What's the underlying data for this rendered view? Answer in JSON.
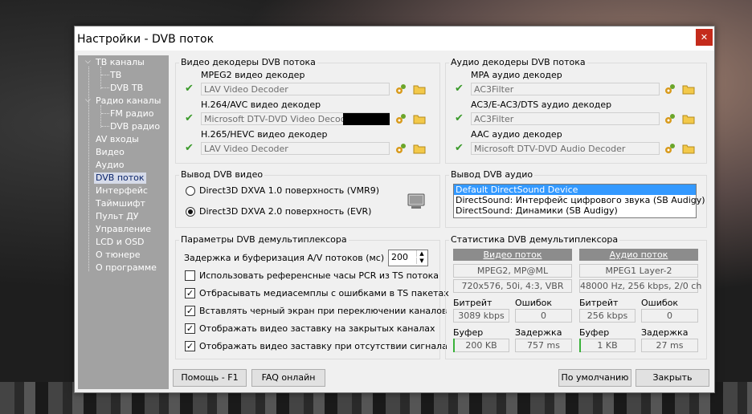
{
  "window": {
    "title": "Настройки - DVB поток",
    "close": "✕"
  },
  "sidebar": {
    "items": [
      {
        "label": "ТВ каналы",
        "toggle": "⌵"
      },
      {
        "label": "ТВ"
      },
      {
        "label": "DVB ТВ"
      },
      {
        "label": "Радио каналы",
        "toggle": "⌵"
      },
      {
        "label": "FM радио"
      },
      {
        "label": "DVB радио"
      },
      {
        "label": "AV входы"
      },
      {
        "label": "Видео"
      },
      {
        "label": "Аудио"
      },
      {
        "label": "DVB поток",
        "selected": true
      },
      {
        "label": "Интерфейс"
      },
      {
        "label": "Таймшифт"
      },
      {
        "label": "Пульт ДУ"
      },
      {
        "label": "Управление"
      },
      {
        "label": "LCD и OSD"
      },
      {
        "label": "О тюнере"
      },
      {
        "label": "О программе"
      }
    ]
  },
  "video_decoders": {
    "title": "Видео декодеры DVB потока",
    "rows": [
      {
        "label": "MPEG2 видео декодер",
        "value": "LAV Video Decoder"
      },
      {
        "label": "H.264/AVC видео декодер",
        "value": "Microsoft DTV-DVD Video Decoder"
      },
      {
        "label": "H.265/HEVC видео декодер",
        "value": "LAV Video Decoder"
      }
    ]
  },
  "audio_decoders": {
    "title": "Аудио декодеры DVB потока",
    "rows": [
      {
        "label": "MPA аудио декодер",
        "value": "AC3Filter"
      },
      {
        "label": "AC3/E-AC3/DTS аудио декодер",
        "value": "AC3Filter"
      },
      {
        "label": "AAC аудио декодер",
        "value": "Microsoft DTV-DVD Audio Decoder"
      }
    ]
  },
  "video_output": {
    "title": "Вывод DVB видео",
    "options": [
      {
        "label": "Direct3D DXVA 1.0 поверхность (VMR9)",
        "checked": false
      },
      {
        "label": "Direct3D DXVA 2.0 поверхность (EVR)",
        "checked": true
      }
    ]
  },
  "audio_output": {
    "title": "Вывод DVB аудио",
    "items": [
      "Default DirectSound Device",
      "DirectSound: Интерфейс цифрового звука (SB Audigy)",
      "DirectSound: Динамики (SB Audigy)"
    ]
  },
  "demux": {
    "title": "Параметры DVB демультиплексора",
    "delay_label": "Задержка и буферизация A/V потоков (мс)",
    "delay_value": "200",
    "options": [
      {
        "label": "Использовать референсные часы PCR из TS потока",
        "checked": false
      },
      {
        "label": "Отбрасывать медиасемплы с ошибками в TS пакетах",
        "checked": true
      },
      {
        "label": "Вставлять черный экран при переключении каналов",
        "checked": true
      },
      {
        "label": "Отображать видео заставку на закрытых каналах",
        "checked": true
      },
      {
        "label": "Отображать видео заставку при отсутствии сигнала",
        "checked": true
      }
    ],
    "check_mark": "✓"
  },
  "stats": {
    "title": "Статистика DVB демультиплексора",
    "video": {
      "header": "Видео поток",
      "format": "MPEG2, MP@ML",
      "params": "720x576, 50i, 4:3, VBR",
      "bitrate_label": "Битрейт",
      "bitrate": "3089 kbps",
      "errors_label": "Ошибок",
      "errors": "0",
      "buffer_label": "Буфер",
      "buffer": "200 KB",
      "delay_label": "Задержка",
      "delay": "757 ms"
    },
    "audio": {
      "header": "Аудио поток",
      "format": "MPEG1 Layer-2",
      "params": "48000 Hz, 256 kbps, 2/0 ch",
      "bitrate_label": "Битрейт",
      "bitrate": "256 kbps",
      "errors_label": "Ошибок",
      "errors": "0",
      "buffer_label": "Буфер",
      "buffer": "1 KB",
      "delay_label": "Задержка",
      "delay": "27 ms"
    }
  },
  "buttons": {
    "help": "Помощь - F1",
    "faq": "FAQ онлайн",
    "defaults": "По умолчанию",
    "close": "Закрыть"
  },
  "colors": {
    "accent": "#3399ff",
    "close": "#c42b1c",
    "check": "#3a9a2a"
  }
}
